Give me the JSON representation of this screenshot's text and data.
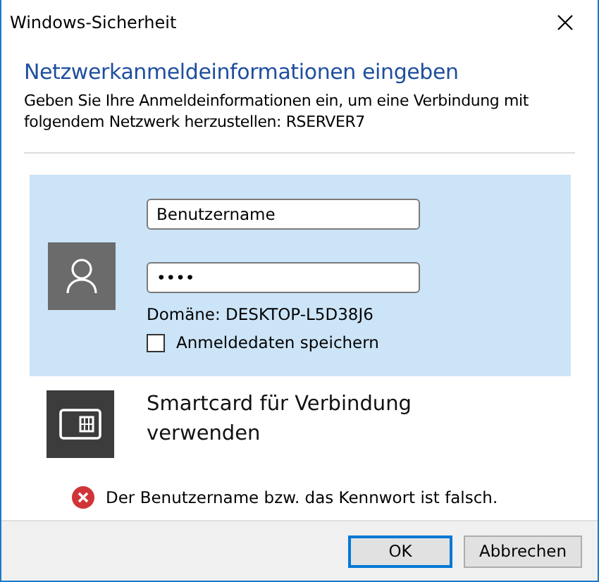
{
  "window": {
    "title": "Windows-Sicherheit"
  },
  "heading": "Netzwerkanmeldeinformationen eingeben",
  "description": "Geben Sie Ihre Anmeldeinformationen ein, um eine Verbindung mit folgendem Netzwerk herzustellen: RSERVER7",
  "credential": {
    "selected": true,
    "username": "Benutzername",
    "password": "••••",
    "domain": "Domäne: DESKTOP-L5D38J6",
    "remember": {
      "label": "Anmeldedaten speichern",
      "checked": false
    }
  },
  "smartcard": {
    "label": "Smartcard für Verbindung verwenden",
    "selected": false
  },
  "error": "Der Benutzername bzw. das Kennwort ist falsch.",
  "buttons": [
    {
      "label": "OK",
      "default": true
    },
    {
      "label": "Abbrechen",
      "default": false
    }
  ]
}
